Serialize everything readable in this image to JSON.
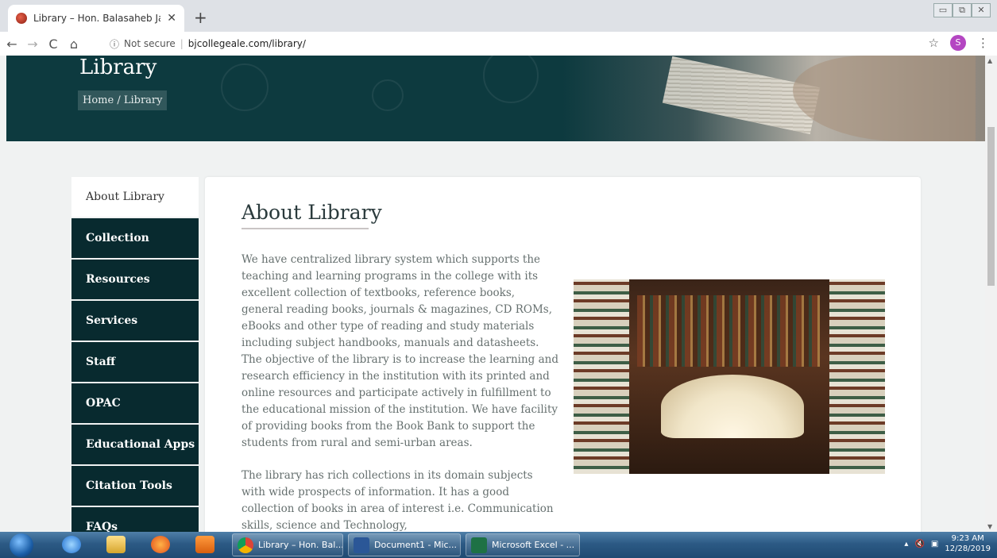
{
  "browser": {
    "tab_title": "Library – Hon. Balasaheb Jadhav",
    "tab_close": "✕",
    "new_tab": "+",
    "security": "Not secure",
    "url": "bjcollegeale.com/library/",
    "profile_initial": "S",
    "window_controls": [
      "▭",
      "⧉",
      "✕"
    ]
  },
  "hero": {
    "title": "Library",
    "breadcrumb": "Home  /  Library"
  },
  "sidebar": {
    "items": [
      {
        "label": "About Library",
        "active": true
      },
      {
        "label": "Collection"
      },
      {
        "label": "Resources"
      },
      {
        "label": "Services"
      },
      {
        "label": "Staff"
      },
      {
        "label": "OPAC"
      },
      {
        "label": "Educational Apps"
      },
      {
        "label": "Citation Tools"
      },
      {
        "label": "FAQs"
      }
    ]
  },
  "main": {
    "heading": "About Library",
    "paragraph1": "We have centralized library system which supports the teaching and learning programs in the college with its excellent collection of textbooks, reference books, general reading books, journals & magazines, CD ROMs, eBooks and other type of reading and study materials including subject handbooks, manuals and datasheets. The objective of the library is to increase the learning and research efficiency in the institution with its printed and online resources and participate actively in fulfillment to the educational mission of the institution. We have facility of providing books from the Book Bank to support the students from rural and semi-urban areas.",
    "paragraph2": "The library has rich collections in its domain subjects with wide prospects of information. It has a good collection of books in area of interest i.e. Communication skills, science and Technology,"
  },
  "taskbar": {
    "buttons": [
      {
        "label": "Library – Hon. Bal...",
        "icon": "chrome-icon"
      },
      {
        "label": "Document1 - Mic...",
        "icon": "word-icon"
      },
      {
        "label": "Microsoft Excel - ...",
        "icon": "excel-icon"
      }
    ],
    "time": "9:23 AM",
    "date": "12/28/2019"
  },
  "colors": {
    "sidebar_bg": "#082a2f",
    "hero_bg": "#0d3a3f",
    "profile": "#b446c2"
  }
}
